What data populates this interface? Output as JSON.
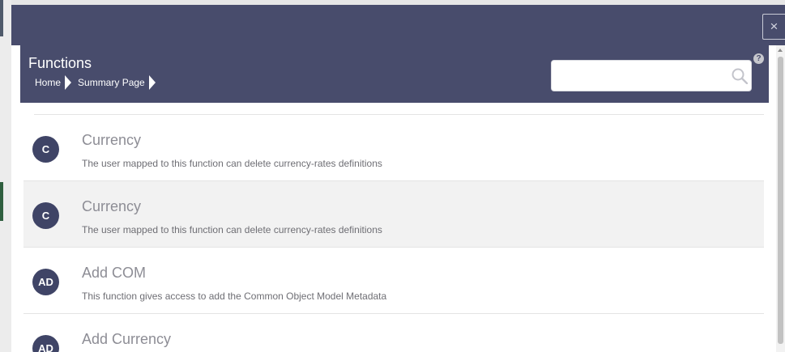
{
  "dialog": {
    "close_symbol": "×"
  },
  "header": {
    "title": "Functions",
    "breadcrumb": [
      "Home",
      "Summary Page"
    ],
    "search": {
      "placeholder": "",
      "value": ""
    },
    "help_symbol": "?"
  },
  "colors": {
    "header_bg": "#484c6c",
    "avatar_bg": "#3f4466",
    "title_text": "#8d8d95",
    "desc_text": "#6e6e74",
    "highlight_row": "#f2f2f2"
  },
  "functions": [
    {
      "initials": "C",
      "title": "Currency",
      "description": "The user mapped to this function can delete currency-rates definitions"
    },
    {
      "initials": "C",
      "title": "Currency",
      "description": "The user mapped to this function can delete currency-rates definitions",
      "highlighted": true
    },
    {
      "initials": "AD",
      "title": "Add COM",
      "description": "This function gives access to add the Common Object Model Metadata"
    },
    {
      "initials": "AD",
      "title": "Add Currency",
      "description": ""
    }
  ],
  "icons": [
    "close-icon",
    "search-icon",
    "help-icon",
    "breadcrumb-arrow-icon"
  ]
}
